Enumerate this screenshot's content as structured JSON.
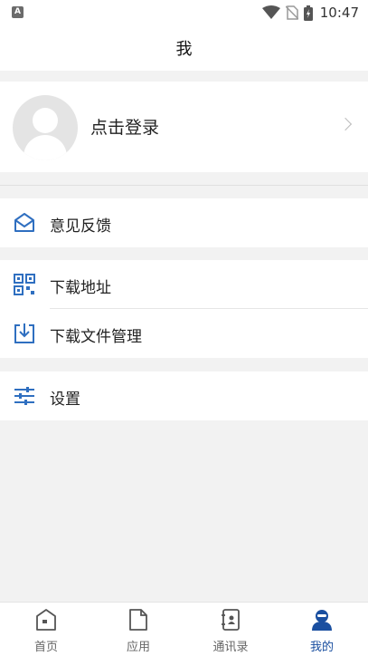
{
  "status_bar": {
    "time": "10:47"
  },
  "header": {
    "title": "我"
  },
  "profile": {
    "login_label": "点击登录"
  },
  "menu": {
    "feedback": "意见反馈",
    "download_address": "下载地址",
    "download_manager": "下载文件管理",
    "settings": "设置"
  },
  "tabs": [
    {
      "label": "首页",
      "icon": "home-icon"
    },
    {
      "label": "应用",
      "icon": "app-icon"
    },
    {
      "label": "通讯录",
      "icon": "contacts-icon"
    },
    {
      "label": "我的",
      "icon": "user-icon",
      "active": true
    }
  ],
  "colors": {
    "accent": "#1a4fa0",
    "icon_blue": "#2f6fc0"
  }
}
